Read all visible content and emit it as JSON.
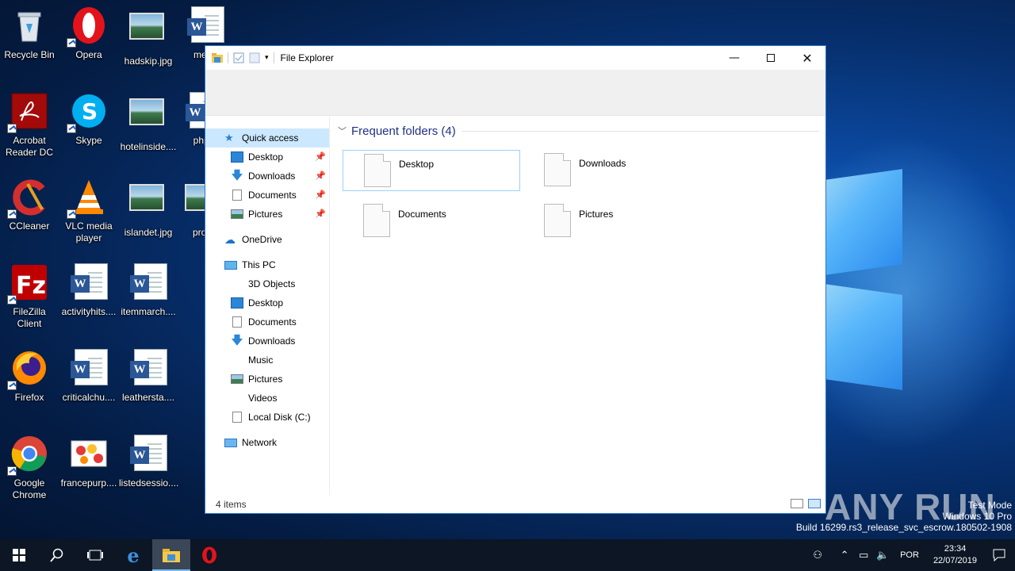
{
  "desktop": {
    "icons": [
      {
        "label": "Recycle Bin",
        "icon": "recycle-bin-icon"
      },
      {
        "label": "Opera",
        "icon": "opera-icon"
      },
      {
        "label": "hadskip.jpg",
        "icon": "image-file-icon"
      },
      {
        "label": "menu",
        "icon": "word-doc-icon"
      },
      {
        "label": "Acrobat Reader DC",
        "icon": "acrobat-icon"
      },
      {
        "label": "Skype",
        "icon": "skype-icon"
      },
      {
        "label": "hotelinside....",
        "icon": "image-file-icon"
      },
      {
        "label": "phpd",
        "icon": "word-doc-icon"
      },
      {
        "label": "CCleaner",
        "icon": "ccleaner-icon"
      },
      {
        "label": "VLC media player",
        "icon": "vlc-icon"
      },
      {
        "label": "islandet.jpg",
        "icon": "image-file-icon"
      },
      {
        "label": "progr",
        "icon": "image-file-icon"
      },
      {
        "label": "FileZilla Client",
        "icon": "filezilla-icon"
      },
      {
        "label": "activityhits....",
        "icon": "word-doc-icon"
      },
      {
        "label": "itemmarch....",
        "icon": "word-doc-icon"
      },
      {
        "label": "Firefox",
        "icon": "firefox-icon"
      },
      {
        "label": "criticalchu....",
        "icon": "word-doc-icon"
      },
      {
        "label": "leathersta....",
        "icon": "word-doc-icon"
      },
      {
        "label": "Google Chrome",
        "icon": "chrome-icon"
      },
      {
        "label": "francepurp....",
        "icon": "image-file-icon"
      },
      {
        "label": "listedsessio....",
        "icon": "word-doc-icon"
      }
    ]
  },
  "explorer": {
    "title": "File Explorer",
    "nav": {
      "quick_access": "Quick access",
      "qa_items": [
        "Desktop",
        "Downloads",
        "Documents",
        "Pictures"
      ],
      "onedrive": "OneDrive",
      "this_pc": "This PC",
      "pc_items": [
        "3D Objects",
        "Desktop",
        "Documents",
        "Downloads",
        "Music",
        "Pictures",
        "Videos",
        "Local Disk (C:)"
      ],
      "network": "Network"
    },
    "section_title": "Frequent folders (4)",
    "folders": [
      "Desktop",
      "Downloads",
      "Documents",
      "Pictures"
    ],
    "status": "4 items"
  },
  "watermark": {
    "brand": "ANY RUN",
    "line1": "Test Mode",
    "line2": "Windows 10 Pro",
    "line3": "Build 16299.rs3_release_svc_escrow.180502-1908"
  },
  "taskbar": {
    "lang": "POR",
    "time": "23:34",
    "date": "22/07/2019"
  },
  "colors": {
    "accent": "#2a78c8",
    "selection": "#cce8ff",
    "section_title": "#1e3287",
    "taskbar": "#0c1624"
  }
}
